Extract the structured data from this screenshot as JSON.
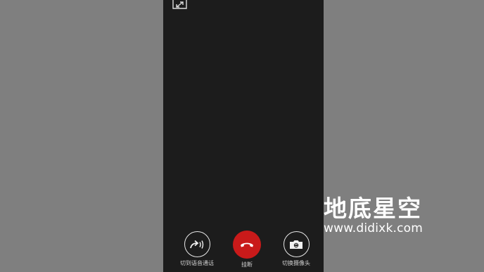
{
  "call": {
    "controls": {
      "switch_voice_label": "切到语音通话",
      "hangup_label": "挂断",
      "switch_camera_label": "切换摄像头"
    },
    "icons": {
      "minimize": "minimize-window-icon",
      "switch_voice": "voice-call-arrow-icon",
      "hangup": "phone-hangup-icon",
      "switch_camera": "camera-switch-icon"
    },
    "colors": {
      "hangup_red": "#c91a1a",
      "video_bg": "#1c1c1c",
      "outside_bg": "#7f7f7f"
    }
  },
  "watermark": {
    "title": "地底星空",
    "url": "www.didixk.com"
  }
}
